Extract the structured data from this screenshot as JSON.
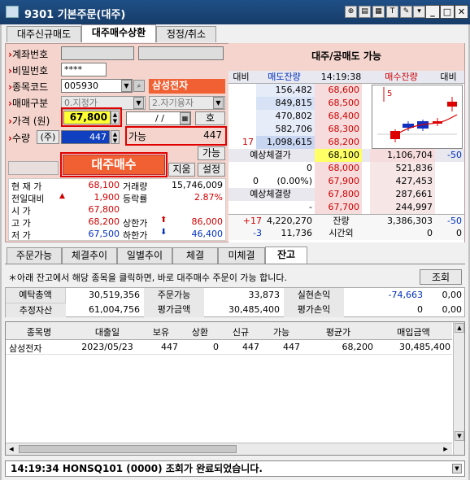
{
  "window": {
    "title": "9301 기본주문(대주)"
  },
  "tabs": [
    "대주신규매도",
    "대주매수상환",
    "정정/취소"
  ],
  "form": {
    "account_label": "계좌번호",
    "account_suffix": "/ /",
    "password_label": "비밀번호",
    "password_value": "****",
    "code_label": "종목코드",
    "code_value": "005930",
    "stock_name": "삼성전자",
    "trade_type_label": "매매구분",
    "trade_type_value": "0.지정가",
    "credit_value": "2.자기융자",
    "price_label": "가격 (원)",
    "price_value": "67,800",
    "date_value": "/ /",
    "ho_label": "호",
    "qty_label": "수량",
    "qty_unit": "(주)",
    "qty_value": "447",
    "avail_label": "가능",
    "avail_value": "447",
    "avail_button": "가능",
    "submit_button": "대주매수",
    "clear_button": "지움",
    "settings_button": "설정"
  },
  "quote": {
    "rows": [
      {
        "l1": "현 재 가",
        "v1": "68,100",
        "l2": "거래량",
        "v2": "15,746,009"
      },
      {
        "l1": "전일대비",
        "v1": "1,900",
        "l2": "등락률",
        "v2": "2.87%"
      },
      {
        "l1": "시 가",
        "v1": "67,800",
        "l2": "",
        "v2": ""
      },
      {
        "l1": "고 가",
        "v1": "68,200",
        "l2": "상한가",
        "v2": "86,000"
      },
      {
        "l1": "저 가",
        "v1": "67,500",
        "l2": "하한가",
        "v2": "46,400"
      }
    ]
  },
  "book": {
    "title": "대주/공매도 가능",
    "headers": [
      "대비",
      "매도잔량",
      "14:19:38",
      "매수잔량",
      "대비"
    ],
    "ask": [
      {
        "qty": "156,482",
        "price": "68,600",
        "diff": ""
      },
      {
        "qty": "849,815",
        "price": "68,500",
        "diff": ""
      },
      {
        "qty": "470,802",
        "price": "68,400",
        "diff": ""
      },
      {
        "qty": "582,706",
        "price": "68,300",
        "diff": ""
      },
      {
        "qty": "1,098,615",
        "price": "68,200",
        "diff": "17"
      }
    ],
    "exp_label": "예상체결가",
    "exp_price": "68,100",
    "exp_bid": "1,106,704",
    "exp_diff": "-50",
    "bid": [
      {
        "price": "68,000",
        "qty": "521,836"
      },
      {
        "price": "67,900",
        "qty": "427,453"
      },
      {
        "price": "67,800",
        "qty": "287,661"
      },
      {
        "price": "67,700",
        "qty": "244,997"
      }
    ],
    "left_vals": [
      {
        "a": "0",
        "b": ""
      },
      {
        "a": "0",
        "b": "(0.00%)"
      }
    ],
    "exp_qty_label": "예상체결량",
    "exp_qty_dash": "-",
    "tot1_diff": "+17",
    "tot1_ask": "4,220,270",
    "tot_label": "잔량",
    "tot_bid": "3,386,303",
    "tot_bid_diff": "-50",
    "tot2_diff": "-3",
    "tot2_ask": "11,736",
    "after_label": "시간외",
    "after_bid": "0",
    "after_diff": "0",
    "chart_label": "5"
  },
  "subtabs": [
    "주문가능",
    "체결추이",
    "일별추이",
    "체결",
    "미체결",
    "잔고"
  ],
  "info": {
    "notice": "＊아래 잔고에서 해당 종목을 클릭하면, 바로 대주매수 주문이 가능 합니다.",
    "lookup_button": "조회"
  },
  "summary": [
    {
      "l1": "예탁총액",
      "v1": "30,519,356",
      "l2": "주문가능",
      "v2": "33,873",
      "l3": "실현손익",
      "v3": "-74,663",
      "v4": "0,00"
    },
    {
      "l1": "추정자산",
      "v1": "61,004,756",
      "l2": "평가금액",
      "v2": "30,485,400",
      "l3": "평가손익",
      "v3": "0",
      "v4": "0,00"
    }
  ],
  "holdings": {
    "headers": [
      "종목명",
      "대출일",
      "보유",
      "상환",
      "신규",
      "가능",
      "평균가",
      "매입금액"
    ],
    "rows": [
      [
        "삼성전자",
        "2023/05/23",
        "447",
        "0",
        "447",
        "447",
        "68,200",
        "30,485,400"
      ]
    ]
  },
  "status": "14:19:34 HONSQ101 (0000) 조회가 완료되었습니다.",
  "colors": {
    "titlebar": "#1f4f86",
    "accent": "#f06033",
    "panel": "#f4d4cc",
    "highlight": "#ffff33"
  }
}
